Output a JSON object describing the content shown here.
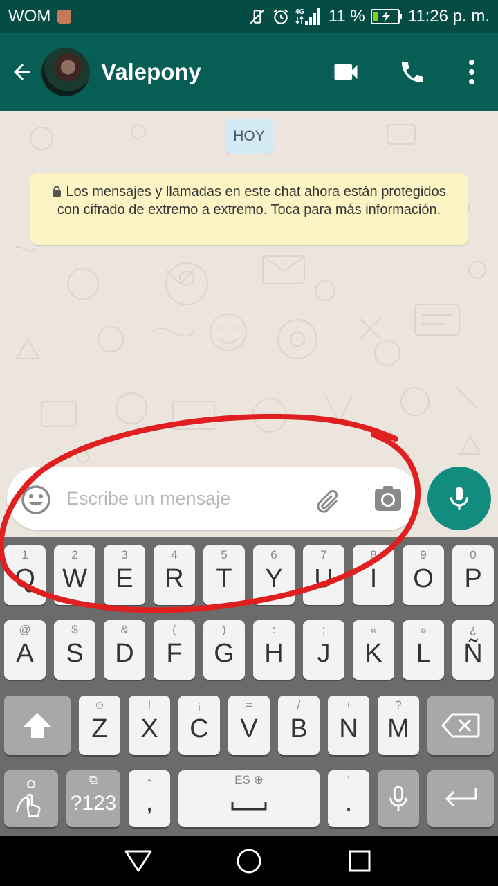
{
  "status_bar": {
    "carrier": "WOM",
    "network": "4G",
    "battery_percent": "11 %",
    "time": "11:26 p. m."
  },
  "header": {
    "contact_name": "Valepony",
    "icons": [
      "back-arrow-icon",
      "video-call-icon",
      "voice-call-icon",
      "more-vert-icon"
    ]
  },
  "chat": {
    "date_chip": "HOY",
    "encryption_notice": "Los mensajes y llamadas en este chat ahora están protegidos con cifrado de extremo a extremo. Toca para más información."
  },
  "composer": {
    "placeholder": "Escribe un mensaje",
    "icons": [
      "emoji-icon",
      "attach-icon",
      "camera-icon",
      "mic-icon"
    ]
  },
  "keyboard": {
    "row1": [
      {
        "hint": "1",
        "key": "Q"
      },
      {
        "hint": "2",
        "key": "W"
      },
      {
        "hint": "3",
        "key": "E"
      },
      {
        "hint": "4",
        "key": "R"
      },
      {
        "hint": "5",
        "key": "T"
      },
      {
        "hint": "6",
        "key": "Y"
      },
      {
        "hint": "7",
        "key": "U"
      },
      {
        "hint": "8",
        "key": "I"
      },
      {
        "hint": "9",
        "key": "O"
      },
      {
        "hint": "0",
        "key": "P"
      }
    ],
    "row2": [
      {
        "hint": "@",
        "key": "A"
      },
      {
        "hint": "$",
        "key": "S"
      },
      {
        "hint": "&",
        "key": "D"
      },
      {
        "hint": "(",
        "key": "F"
      },
      {
        "hint": ")",
        "key": "G"
      },
      {
        "hint": ":",
        "key": "H"
      },
      {
        "hint": ";",
        "key": "J"
      },
      {
        "hint": "«",
        "key": "K"
      },
      {
        "hint": "»",
        "key": "L"
      },
      {
        "hint": "¿",
        "key": "Ñ"
      }
    ],
    "row3": [
      {
        "hint": "☺",
        "key": "Z"
      },
      {
        "hint": "!",
        "key": "X"
      },
      {
        "hint": "¡",
        "key": "C"
      },
      {
        "hint": "=",
        "key": "V"
      },
      {
        "hint": "/",
        "key": "B"
      },
      {
        "hint": "+",
        "key": "N"
      },
      {
        "hint": "?",
        "key": "M"
      }
    ],
    "row4": {
      "symbols_label": "?123",
      "comma_hint": "-",
      "comma": ",",
      "space_hint": "ES",
      "period_hint": "'",
      "period": "."
    }
  },
  "colors": {
    "status_bar": "#054d44",
    "app_bar": "#075e54",
    "mic_button": "#128c7e",
    "chat_background": "#ece5dd",
    "notice_background": "#fdf4c5",
    "date_chip": "#d4eaf4",
    "annotation": "#e02020"
  }
}
